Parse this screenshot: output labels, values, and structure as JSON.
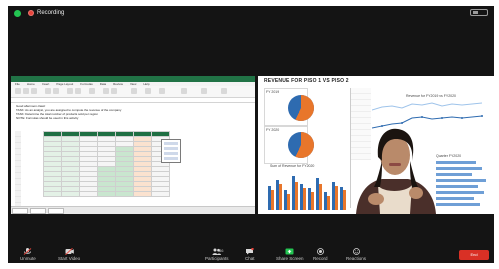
{
  "window": {
    "recording_label": "Recording"
  },
  "excel": {
    "menu": [
      "File",
      "Home",
      "Insert",
      "Page Layout",
      "Formulas",
      "Data",
      "Review",
      "View",
      "Help"
    ],
    "notes": [
      "Good afternoon class!",
      "TASK: As an analyst, you are assigned to compute the revenue of the company",
      "TASK: Determine the total number of products sold per region",
      "NOTE: Formulas should be used in this activity"
    ]
  },
  "dashboard": {
    "title": "REVENUE FOR PISO 1 VS PISO 2",
    "pie1_label": "FY 2019",
    "pie2_label": "FY 2020",
    "line_chart_title": "Revenue for FY2019 vs FY2020",
    "bar_chart_title": "Sum of Revenue for FY2020",
    "hbar_chart_title": "Quarter FY2020"
  },
  "toolbar": {
    "unmute": "Unmute",
    "start_video": "Start Video",
    "participants": "Participants",
    "participants_count": "86",
    "chat": "Chat",
    "share_screen": "Share Screen",
    "record": "Record",
    "reactions": "Reactions",
    "end": "End",
    "colors": {
      "end": "#d93025",
      "share": "#23c552"
    }
  },
  "icons": [
    "shield-icon",
    "record-icon",
    "view-icon",
    "microphone-muted-icon",
    "video-off-icon",
    "participants-icon",
    "chat-icon",
    "share-screen-icon",
    "record-button-icon",
    "reactions-icon"
  ]
}
